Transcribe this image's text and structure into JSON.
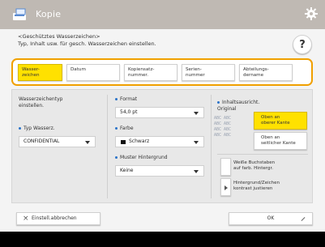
{
  "titlebar": {
    "title": "Kopie",
    "app_icon": "copier-icon",
    "settings_icon": "gear-icon"
  },
  "instruction": {
    "line1": "<Geschütztes Wasserzeichen>",
    "line2": "Typ, Inhalt usw. für gesch. Wasserzeichen einstellen."
  },
  "help": {
    "label": "?"
  },
  "tabs": [
    {
      "label": "Wasser-\nzeichen",
      "active": true
    },
    {
      "label": "Datum",
      "active": false
    },
    {
      "label": "Kopiensatz-\nnummer.",
      "active": false
    },
    {
      "label": "Serien-\nnummer",
      "active": false
    },
    {
      "label": "Abteilungs-\ndername",
      "active": false
    }
  ],
  "watermark_type": {
    "heading": "Wasserzeichentyp\neinstellen.",
    "type_label": "Typ Wasserz.",
    "type_value": "CONFIDENTIAL"
  },
  "format": {
    "label": "Format",
    "value": "54,0 pt"
  },
  "color": {
    "label": "Farbe",
    "value": "Schwarz"
  },
  "pattern": {
    "label": "Muster Hintergrund",
    "value": "Keine"
  },
  "orientation": {
    "label": "Inhaltsausricht.\nOriginal",
    "option_top": "Oben an\noberer Kante",
    "option_left": "Oben an\nseitlicher Kante",
    "image_text": "ABC ABC\nABC ABC\nABC ABC\nABC ABC"
  },
  "options": {
    "white_letters": "Weiße Buchstaben\nauf farb. Hintergr.",
    "contrast": "Hintergrund/Zeichen\nkontrast justieren"
  },
  "footer": {
    "cancel_label": "Einstell.abbrechen",
    "ok_label": "OK"
  },
  "colors": {
    "accent": "#f0a000",
    "active_tab": "#ffe100",
    "titlebar": "#bfb9b3",
    "panel": "#f4f4f4"
  }
}
